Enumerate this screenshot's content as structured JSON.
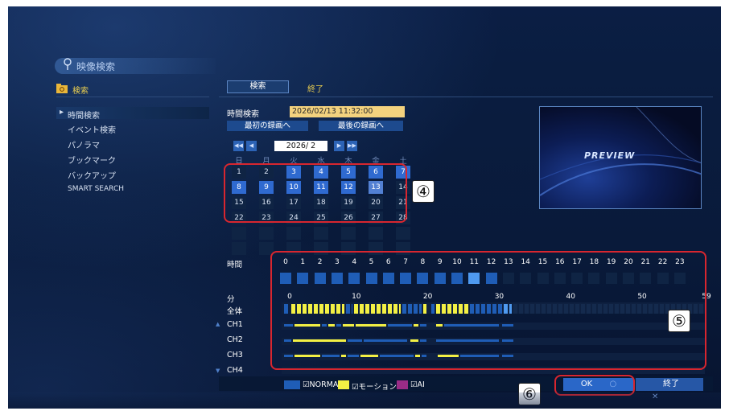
{
  "header": {
    "title": "映像検索",
    "search_label": "検索"
  },
  "sidebar": {
    "items": [
      {
        "label": "時間検索",
        "selected": true
      },
      {
        "label": "イベント検索"
      },
      {
        "label": "パノラマ"
      },
      {
        "label": "ブックマーク"
      },
      {
        "label": "バックアップ"
      },
      {
        "label": "SMART SEARCH"
      }
    ]
  },
  "tabs": {
    "search": "検索",
    "exit": "終了"
  },
  "time_search": {
    "label": "時間検索",
    "datetime": "2026/02/13 11:32:00",
    "first_record_button": "最初の録画へ",
    "last_record_button": "最後の録画へ"
  },
  "calendar": {
    "month": "2026/ 2",
    "weekdays": [
      "日",
      "月",
      "火",
      "水",
      "木",
      "金",
      "土"
    ],
    "days": [
      "1",
      "2",
      "3",
      "4",
      "5",
      "6",
      "7",
      "8",
      "9",
      "10",
      "11",
      "12",
      "13",
      "14",
      "15",
      "16",
      "17",
      "18",
      "19",
      "20",
      "21",
      "22",
      "23",
      "24",
      "25",
      "26",
      "27",
      "28"
    ],
    "recorded_days": [
      3,
      4,
      5,
      6,
      7,
      8,
      9,
      10,
      11,
      12,
      13
    ]
  },
  "preview": {
    "label": "PREVIEW"
  },
  "timeline": {
    "hour_label": "時間",
    "hours": [
      "0",
      "1",
      "2",
      "3",
      "4",
      "5",
      "6",
      "7",
      "8",
      "9",
      "10",
      "11",
      "12",
      "13",
      "14",
      "15",
      "16",
      "17",
      "18",
      "19",
      "20",
      "21",
      "22",
      "23"
    ],
    "recorded_hours": 13,
    "selected_hour": 11,
    "minute_label": "分",
    "minute_ticks": [
      "0",
      "10",
      "20",
      "30",
      "40",
      "50",
      "59"
    ],
    "rows": [
      {
        "label": "全体"
      },
      {
        "label": "CH1"
      },
      {
        "label": "CH2"
      },
      {
        "label": "CH3"
      },
      {
        "label": "CH4"
      }
    ]
  },
  "legend": {
    "normal": "NORMAL",
    "motion": "モーション",
    "ai": "AI"
  },
  "buttons": {
    "ok": "OK",
    "end": "終了"
  },
  "callouts": {
    "calendar": "④",
    "timeline": "⑤",
    "ok": "⑥"
  },
  "colors": {
    "normal": "#1f5db6",
    "motion": "#f3f044",
    "ai": "#9a2c86",
    "datetime_bg": "#f3d27e"
  }
}
